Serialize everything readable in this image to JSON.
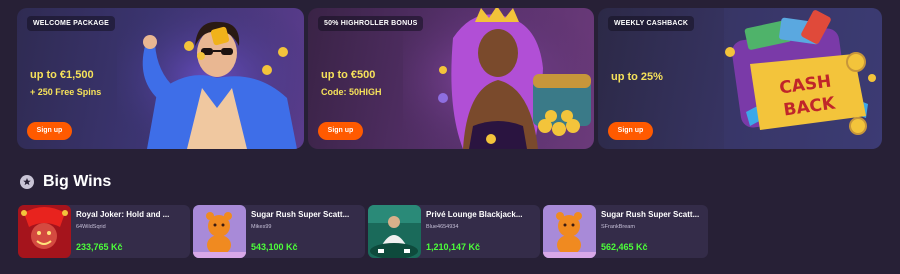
{
  "promos": [
    {
      "badge": "WELCOME PACKAGE",
      "line1": "up to €1,500",
      "line2": "+ 250 Free Spins",
      "cta": "Sign up"
    },
    {
      "badge": "50% HIGHROLLER BONUS",
      "line1": "up to €500",
      "line2": "Code: 50HIGH",
      "cta": "Sign up"
    },
    {
      "badge": "WEEKLY CASHBACK",
      "line1": "up to 25%",
      "cta": "Sign up",
      "art_text": [
        "CASH",
        "BACK"
      ]
    }
  ],
  "big_wins": {
    "title": "Big Wins",
    "icon": "star-badge-icon",
    "items": [
      {
        "game": "Royal Joker: Hold and ...",
        "user": "64WildSqrid",
        "amount": "233,765 Kč"
      },
      {
        "game": "Sugar Rush Super Scatt...",
        "user": "Mikes99",
        "amount": "543,100 Kč"
      },
      {
        "game": "Privé Lounge Blackjack...",
        "user": "Blue4654934",
        "amount": "1,210,147 Kč"
      },
      {
        "game": "Sugar Rush Super Scatt...",
        "user": "SFrankBream",
        "amount": "562,465 Kč"
      }
    ]
  },
  "colors": {
    "background": "#272036",
    "cta": "#ff5a00",
    "offer_text": "#f6e25a",
    "win_amount": "#4cff3a"
  }
}
